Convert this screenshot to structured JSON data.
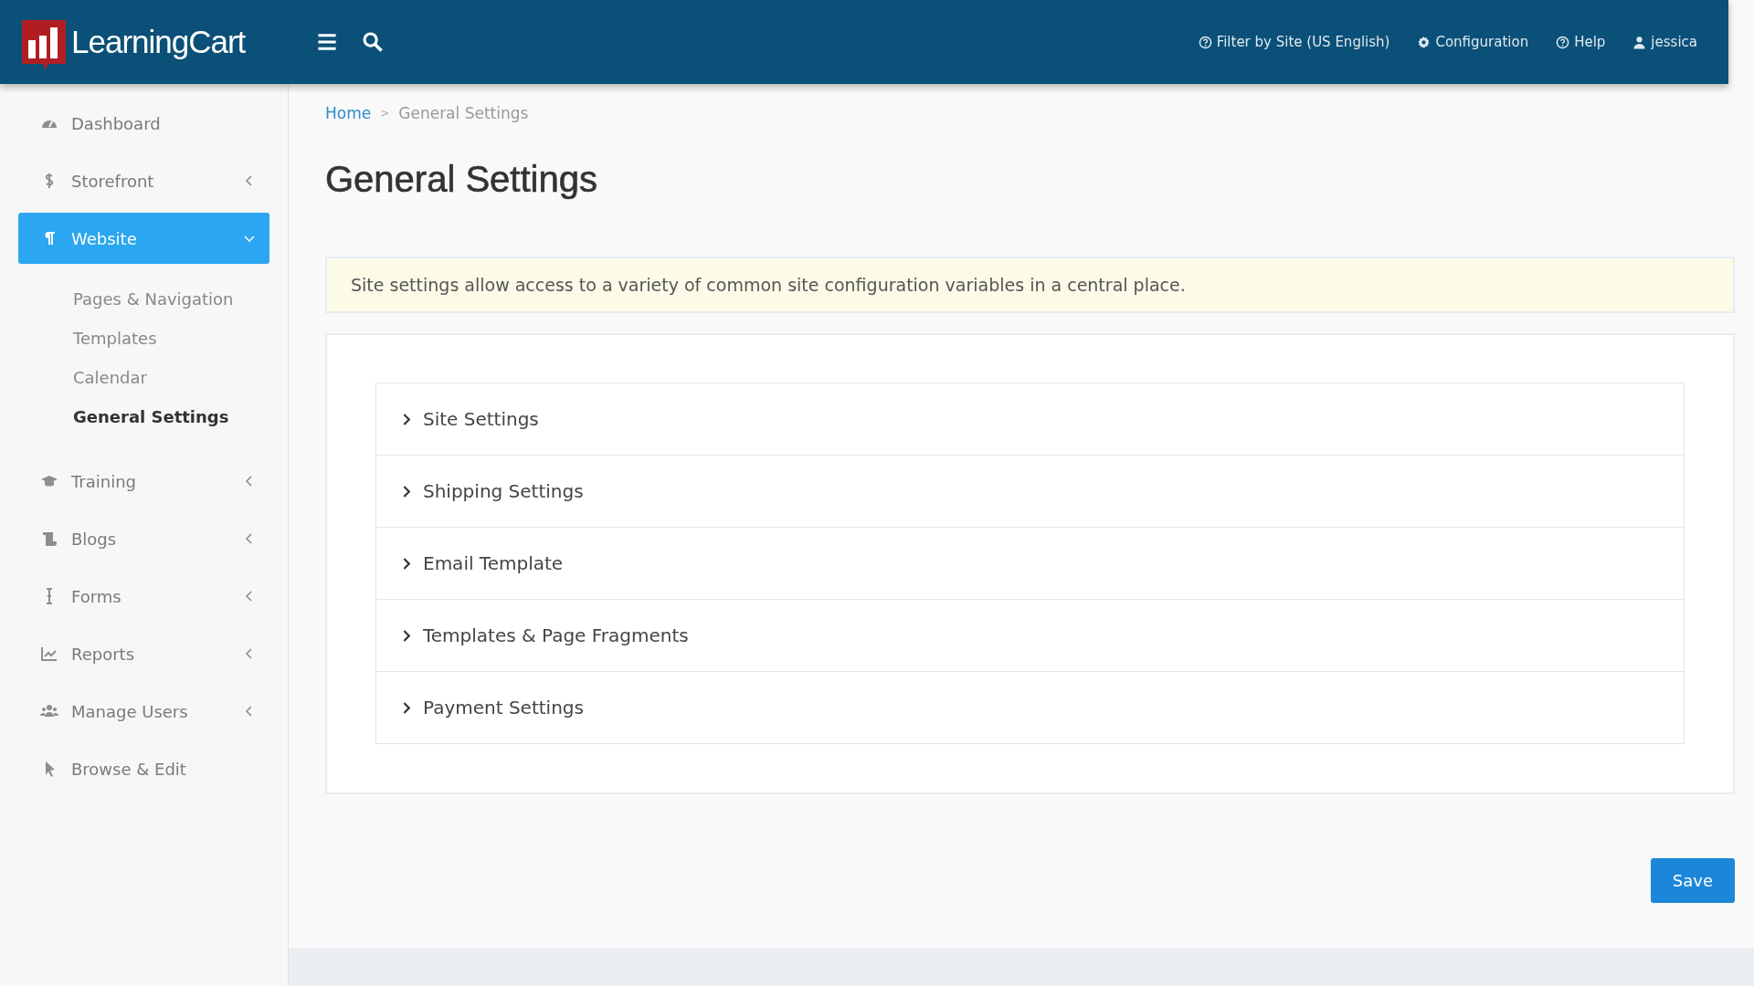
{
  "header": {
    "logo": "LearningCart",
    "links": [
      {
        "kind": "help",
        "label": "Filter by Site (US English)"
      },
      {
        "kind": "gear",
        "label": "Configuration"
      },
      {
        "kind": "help",
        "label": "Help"
      },
      {
        "kind": "user",
        "label": "jessica"
      }
    ]
  },
  "sidebar": {
    "items": [
      {
        "label": "Dashboard",
        "selected": false
      },
      {
        "label": "Storefront",
        "selected": false,
        "expanded": false
      },
      {
        "label": "Website",
        "selected": true,
        "expanded": true,
        "children": [
          {
            "label": "Pages & Navigation",
            "selected": false
          },
          {
            "label": "Templates",
            "selected": false
          },
          {
            "label": "Calendar",
            "selected": false
          },
          {
            "label": "General Settings",
            "selected": true
          }
        ]
      },
      {
        "label": "Training",
        "selected": false,
        "expanded": false
      },
      {
        "label": "Blogs",
        "selected": false,
        "expanded": false
      },
      {
        "label": "Forms",
        "selected": false,
        "expanded": false
      },
      {
        "label": "Reports",
        "selected": false,
        "expanded": false
      },
      {
        "label": "Manage Users",
        "selected": false,
        "expanded": false
      },
      {
        "label": "Browse & Edit",
        "selected": false
      }
    ]
  },
  "breadcrumb": {
    "separator": ">",
    "items": [
      "Home",
      "General Settings"
    ]
  },
  "title": "General Settings",
  "info": "Site settings allow access to a variety of common site configuration variables in a central place.",
  "sections": [
    {
      "label": "Site Settings",
      "expanded": false
    },
    {
      "label": "Shipping Settings",
      "expanded": false
    },
    {
      "label": "Email Template",
      "expanded": false
    },
    {
      "label": "Templates & Page Fragments",
      "expanded": false
    },
    {
      "label": "Payment Settings",
      "expanded": false
    }
  ],
  "save_button": "Save"
}
